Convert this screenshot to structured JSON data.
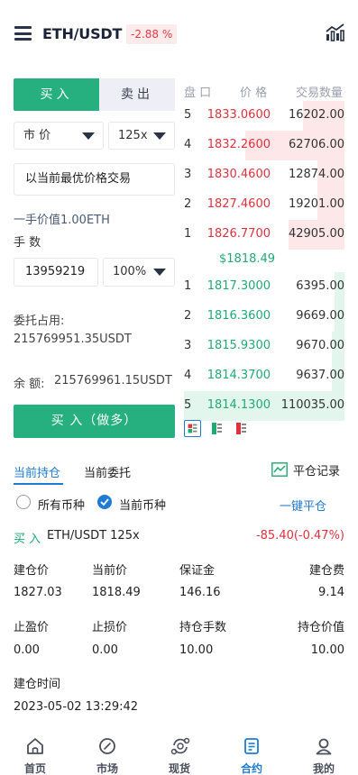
{
  "header": {
    "pair": "ETH/USDT",
    "change": "-2.88 %"
  },
  "order_form": {
    "tab_buy": "买入",
    "tab_sell": "卖出",
    "order_type": "市 价",
    "leverage": "125x",
    "price_input": "以当前最优价格交易",
    "lot_value": "一手价值1.00ETH",
    "qty_label": "手 数",
    "qty_value": "13959219",
    "percent": "100%",
    "margin_label": "委托占用:",
    "margin_value": "215769951.35USDT",
    "balance_label": "余 额:",
    "balance_value": "215769961.15USDT",
    "submit": "买 入（做多）"
  },
  "order_book": {
    "headers": {
      "level": "盘 口",
      "price": "价 格",
      "qty": "交易数量"
    },
    "asks": [
      {
        "idx": "5",
        "price": "1833.0600",
        "qty": "16202.00",
        "depth": 0.26
      },
      {
        "idx": "4",
        "price": "1832.2600",
        "qty": "62706.00",
        "depth": 0.62
      },
      {
        "idx": "3",
        "price": "1830.4600",
        "qty": "12874.00",
        "depth": 0.17
      },
      {
        "idx": "2",
        "price": "1827.4600",
        "qty": "19201.00",
        "depth": 0.17
      },
      {
        "idx": "1",
        "price": "1826.7700",
        "qty": "42905.00",
        "depth": 0.35
      }
    ],
    "mid_price": "$1818.49",
    "bids": [
      {
        "idx": "1",
        "price": "1817.3000",
        "qty": "6395.00",
        "depth": 0.06
      },
      {
        "idx": "2",
        "price": "1816.3600",
        "qty": "9669.00",
        "depth": 0.06
      },
      {
        "idx": "3",
        "price": "1815.9300",
        "qty": "9670.00",
        "depth": 0.08
      },
      {
        "idx": "4",
        "price": "1814.3700",
        "qty": "9637.00",
        "depth": 0.08
      },
      {
        "idx": "5",
        "price": "1814.1300",
        "qty": "110035.00",
        "depth": 1.0
      }
    ]
  },
  "positions": {
    "tab_current": "当前持仓",
    "tab_orders": "当前委托",
    "record": "平仓记录",
    "filter_all": "所有币种",
    "filter_current": "当前币种",
    "close_all": "一键平仓",
    "side": "买 入",
    "pair": "ETH/USDT 125x",
    "pnl": "-85.40(-0.47%)",
    "fields": {
      "open_price_label": "建仓价",
      "open_price": "1827.03",
      "current_price_label": "当前价",
      "current_price": "1818.49",
      "margin_label": "保证金",
      "margin": "146.16",
      "fee_label": "建仓费",
      "fee": "9.14",
      "tp_label": "止盈价",
      "tp": "0.00",
      "sl_label": "止损价",
      "sl": "0.00",
      "lots_label": "持仓手数",
      "lots": "10.00",
      "value_label": "持仓价值",
      "value": "10.00",
      "time_label": "建仓时间",
      "time": "2023-05-02 13:29:42"
    }
  },
  "nav": {
    "home": "首页",
    "market": "市场",
    "spot": "现货",
    "contract": "合约",
    "mine": "我的"
  },
  "colors": {
    "buy_green": "#26b07f",
    "sell_red": "#e0313d",
    "accent_blue": "#1f7ad1"
  }
}
